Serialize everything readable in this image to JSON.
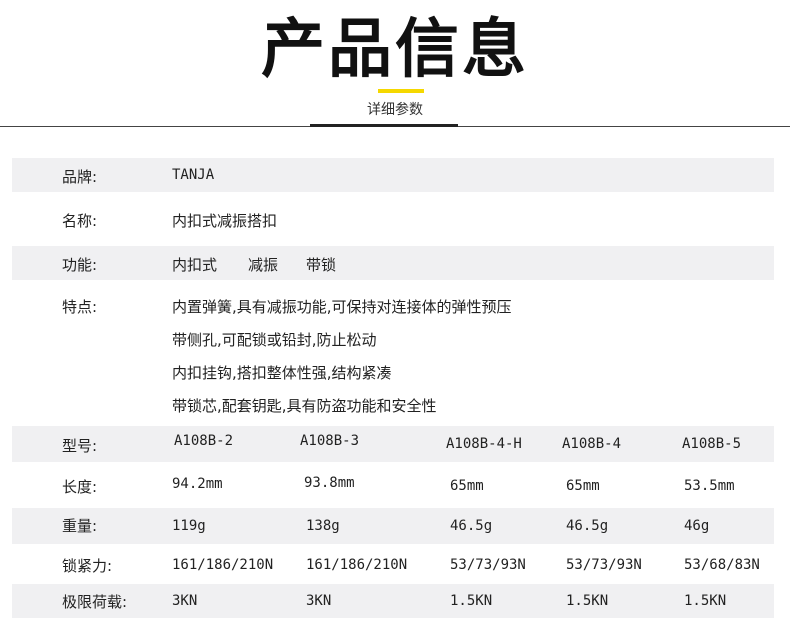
{
  "header": {
    "title": "产品信息",
    "subtitle": "详细参数"
  },
  "brand": {
    "label": "品牌:",
    "value": "TANJA"
  },
  "name": {
    "label": "名称:",
    "value": "内扣式减振搭扣"
  },
  "function": {
    "label": "功能:",
    "values": [
      "内扣式",
      "减振",
      "带锁"
    ]
  },
  "features": {
    "label": "特点:",
    "lines": [
      "内置弹簧,具有减振功能,可保持对连接体的弹性预压",
      "带侧孔,可配锁或铅封,防止松动",
      "内扣挂钩,搭扣整体性强,结构紧凑",
      "带锁芯,配套钥匙,具有防盗功能和安全性"
    ]
  },
  "model": {
    "label": "型号:",
    "values": [
      "A108B-2",
      "A108B-3",
      "A108B-4-H",
      "A108B-4",
      "A108B-5"
    ]
  },
  "length": {
    "label": "长度:",
    "values": [
      "94.2mm",
      "93.8mm",
      "65mm",
      "65mm",
      "53.5mm"
    ]
  },
  "weight": {
    "label": "重量:",
    "values": [
      "119g",
      "138g",
      "46.5g",
      "46.5g",
      "46g"
    ]
  },
  "lock_force": {
    "label": "锁紧力:",
    "values": [
      "161/186/210N",
      "161/186/210N",
      "53/73/93N",
      "53/73/93N",
      "53/68/83N"
    ]
  },
  "load_limit": {
    "label": "极限荷载:",
    "values": [
      "3KN",
      "3KN",
      "1.5KN",
      "1.5KN",
      "1.5KN"
    ]
  }
}
